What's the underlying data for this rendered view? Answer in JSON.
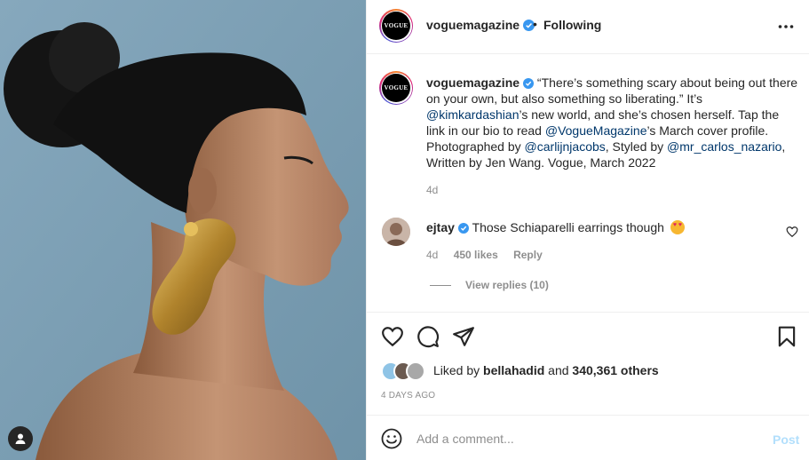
{
  "post": {
    "username": "voguemagazine",
    "separator": "•",
    "follow_status": "Following",
    "avatar_logo_text": "VOGUE",
    "caption_parts": {
      "p1": "“There’s something scary about being out there on your own, but also something so liberating.” It’s ",
      "m1": "@kimkardashian",
      "p2": "’s new world, and she’s chosen herself. Tap the link in our bio to read ",
      "m2": "@VogueMagazine",
      "p3": "’s March cover profile. Photographed by ",
      "m3": "@carlijnjacobs",
      "p4": ", Styled by ",
      "m4": "@mr_carlos_nazario",
      "p5": ", Written by Jen Wang. Vogue, March 2022"
    },
    "caption_time": "4d"
  },
  "comment": {
    "username": "ejtay",
    "text": "Those Schiaparelli earrings though",
    "time": "4d",
    "likes": "450 likes",
    "reply": "Reply",
    "view_replies": "View replies (10)"
  },
  "likes": {
    "prefix": "Liked by ",
    "user": "bellahadid",
    "middle": " and ",
    "count": "340,361 others"
  },
  "timestamp": "4 DAYS AGO",
  "add_comment": {
    "placeholder": "Add a comment...",
    "post_label": "Post"
  },
  "icons": {
    "more": "more-options-icon",
    "like": "heart-icon",
    "comment": "comment-icon",
    "share": "paper-plane-icon",
    "save": "bookmark-icon",
    "emoji": "smiley-icon",
    "tag": "user-tag-icon",
    "verified": "verified-badge-icon"
  },
  "colors": {
    "link": "#00376b",
    "verified": "#3897f0",
    "post_disabled": "#b2dffc",
    "photo_background": "#7c9fb4"
  }
}
